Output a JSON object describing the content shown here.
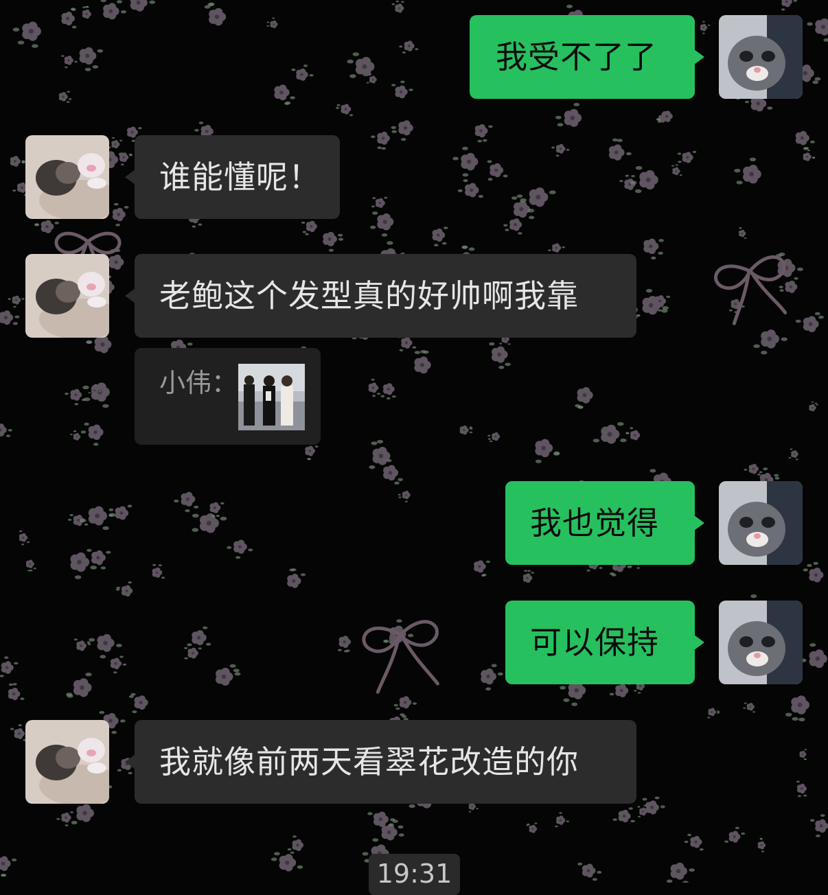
{
  "messages": [
    {
      "direction": "outgoing",
      "text": "我受不了了",
      "avatar": "kitten-gray-avatar"
    },
    {
      "direction": "incoming",
      "text": "谁能懂呢！",
      "avatar": "kitten-lying-avatar"
    },
    {
      "direction": "incoming",
      "text": "老鲍这个发型真的好帅啊我靠",
      "avatar": "kitten-lying-avatar"
    },
    {
      "direction": "incoming-quote",
      "sender": "小伟：",
      "attachment": "photo-thumbnail-three-people-beach"
    },
    {
      "direction": "outgoing",
      "text": "我也觉得",
      "avatar": "kitten-gray-avatar"
    },
    {
      "direction": "outgoing",
      "text": "可以保持",
      "avatar": "kitten-gray-avatar"
    },
    {
      "direction": "incoming",
      "text": "我就像前两天看翠花改造的你",
      "avatar": "kitten-lying-avatar"
    }
  ],
  "timestamp": "19:31",
  "colors": {
    "background": "#050505",
    "incoming_bubble": "#2c2c2c",
    "outgoing_bubble": "#27c05f",
    "wallpaper_flower": "#5e5560",
    "wallpaper_leaf": "#6f8570",
    "wallpaper_bow": "#6a5a66"
  },
  "wallpaper": "black background with small mauve flowers and ribbon bows"
}
